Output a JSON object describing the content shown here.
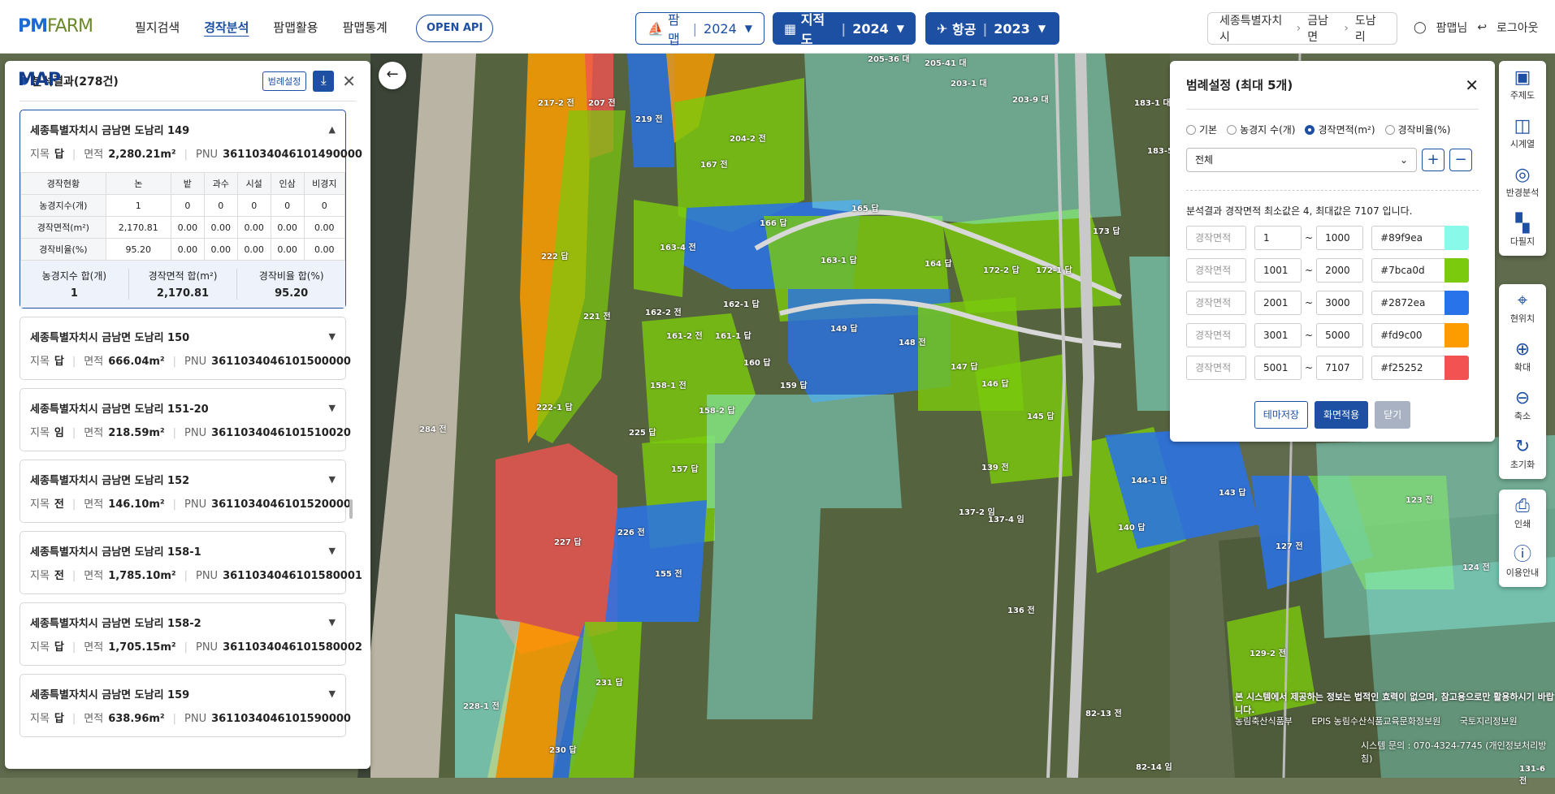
{
  "header": {
    "logo": {
      "pm": "PM",
      "farm": "FARM",
      "map": "MAP"
    },
    "nav": [
      "필지검색",
      "경작분석",
      "팜맵활용",
      "팜맵통계"
    ],
    "nav_active": 1,
    "api_button": "OPEN API",
    "dropdowns": [
      {
        "label": "팜맵",
        "year": "2024",
        "icon": "farm-icon"
      },
      {
        "label": "지적도",
        "year": "2024",
        "icon": "map-icon"
      },
      {
        "label": "항공",
        "year": "2023",
        "icon": "plane-icon"
      }
    ],
    "breadcrumb": [
      "세종특별자치시",
      "금남면",
      "도남리"
    ],
    "user_label": "팜맵님",
    "logout_label": "로그아웃"
  },
  "left_panel": {
    "title": "분석결과(278건)",
    "legend_button": "범례설정",
    "expanded": {
      "address": "세종특별자치시 금남면 도남리 149",
      "jimok_label": "지목",
      "jimok": "답",
      "area_label": "면적",
      "area": "2,280.21m²",
      "pnu_label": "PNU",
      "pnu": "3611034046101490000",
      "table_headers": [
        "경작현황",
        "논",
        "밭",
        "과수",
        "시설",
        "인삼",
        "비경지"
      ],
      "table_rows": [
        [
          "농경지수(개)",
          "1",
          "0",
          "0",
          "0",
          "0",
          "0"
        ],
        [
          "경작면적(m²)",
          "2,170.81",
          "0.00",
          "0.00",
          "0.00",
          "0.00",
          "0.00"
        ],
        [
          "경작비율(%)",
          "95.20",
          "0.00",
          "0.00",
          "0.00",
          "0.00",
          "0.00"
        ]
      ],
      "sums": [
        {
          "label": "농경지수 합(개)",
          "value": "1"
        },
        {
          "label": "경작면적 합(m²)",
          "value": "2,170.81"
        },
        {
          "label": "경작비율 합(%)",
          "value": "95.20"
        }
      ]
    },
    "items": [
      {
        "address": "세종특별자치시 금남면 도남리 150",
        "jimok": "답",
        "area": "666.04m²",
        "pnu": "3611034046101500000"
      },
      {
        "address": "세종특별자치시 금남면 도남리 151-20",
        "jimok": "임",
        "area": "218.59m²",
        "pnu": "3611034046101510020"
      },
      {
        "address": "세종특별자치시 금남면 도남리 152",
        "jimok": "전",
        "area": "146.10m²",
        "pnu": "3611034046101520000"
      },
      {
        "address": "세종특별자치시 금남면 도남리 158-1",
        "jimok": "전",
        "area": "1,785.10m²",
        "pnu": "3611034046101580001"
      },
      {
        "address": "세종특별자치시 금남면 도남리 158-2",
        "jimok": "답",
        "area": "1,705.15m²",
        "pnu": "3611034046101580002"
      },
      {
        "address": "세종특별자치시 금남면 도남리 159",
        "jimok": "답",
        "area": "638.96m²",
        "pnu": "3611034046101590000"
      }
    ]
  },
  "legend_panel": {
    "title": "범례설정 (최대 5개)",
    "radios": [
      "기본",
      "농경지 수(개)",
      "경작면적(m²)",
      "경작비율(%)"
    ],
    "radio_selected": 2,
    "select_value": "전체",
    "info": "분석결과 경작면적 최소값은 4, 최대값은 7107 입니다.",
    "rows": [
      {
        "label": "경작면적",
        "min": "1",
        "max": "1000",
        "color": "#89f9ea"
      },
      {
        "label": "경작면적",
        "min": "1001",
        "max": "2000",
        "color": "#7bca0d"
      },
      {
        "label": "경작면적",
        "min": "2001",
        "max": "3000",
        "color": "#2872ea"
      },
      {
        "label": "경작면적",
        "min": "3001",
        "max": "5000",
        "color": "#fd9c00"
      },
      {
        "label": "경작면적",
        "min": "5001",
        "max": "7107",
        "color": "#f25252"
      }
    ],
    "buttons": [
      "테마저장",
      "화면적용",
      "닫기"
    ]
  },
  "toolbar_top": [
    {
      "label": "주제도",
      "icon": "theme-map-icon"
    },
    {
      "label": "시계열",
      "icon": "timeseries-icon"
    },
    {
      "label": "반경분석",
      "icon": "radius-icon"
    },
    {
      "label": "다필지",
      "icon": "multi-parcel-icon"
    }
  ],
  "toolbar_mid": [
    {
      "label": "현위치",
      "icon": "location-icon"
    },
    {
      "label": "확대",
      "icon": "zoom-in-icon"
    },
    {
      "label": "축소",
      "icon": "zoom-out-icon"
    },
    {
      "label": "초기화",
      "icon": "reset-icon"
    }
  ],
  "toolbar_bot": [
    {
      "label": "인쇄",
      "icon": "print-icon"
    },
    {
      "label": "이용안내",
      "icon": "info-icon"
    }
  ],
  "map_labels": [
    "217-2 전",
    "207 전",
    "219 전",
    "204-2 전",
    "167 전",
    "166 답",
    "163-4 전",
    "163-1 답",
    "165 답",
    "164 답",
    "172-2 답",
    "172-1 답",
    "173 답",
    "222 답",
    "221 전",
    "162-1 답",
    "162-2 전",
    "161-2 전",
    "161-1 답",
    "160 답",
    "149 답",
    "148 전",
    "147 답",
    "146 답",
    "158-1 전",
    "158-2 답",
    "159 답",
    "157 답",
    "145 답",
    "139 전",
    "144-1 답",
    "143 답",
    "140 답",
    "127 전",
    "123 전",
    "124 전",
    "129-2 전",
    "227 답",
    "155 전",
    "226 전",
    "225 답",
    "231 답",
    "230 답",
    "222-1 답",
    "284 전",
    "228-1 전",
    "205-36 대",
    "205-41 대",
    "203-1 대",
    "203-9 대",
    "183-1 대",
    "183-5 임",
    "137-2 임",
    "137-4 임",
    "136 전",
    "82-13 전",
    "82-14 임",
    "131-6 전"
  ],
  "disclaimer": "본 시스템에서 제공하는 정보는 법적인 효력이 없으며, 참고용으로만 활용하시기 바랍니다.",
  "orgs": [
    "농림축산식품부",
    "EPIS 농림수산식품교육문화정보원",
    "국토지리정보원"
  ],
  "contact": "시스템 문의 : 070-4324-7745 (개인정보처리방침)"
}
